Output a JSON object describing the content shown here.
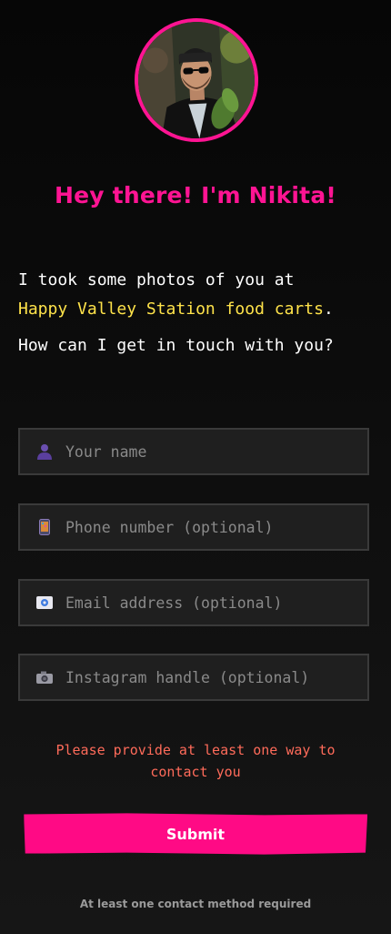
{
  "profile": {
    "avatar_alt": "Nikita profile photo",
    "accent_color": "#ff1493"
  },
  "greeting": "Hey there! I'm Nikita!",
  "intro": {
    "line_before": "I took some photos of you at",
    "location": "Happy Valley Station food carts",
    "line_after": ".",
    "question": "How can I get in touch with you?"
  },
  "form": {
    "name": {
      "placeholder": "Your name",
      "value": "",
      "icon": "person-icon"
    },
    "phone": {
      "placeholder": "Phone number (optional)",
      "value": "",
      "icon": "phone-icon"
    },
    "email": {
      "placeholder": "Email address (optional)",
      "value": "",
      "icon": "email-icon"
    },
    "instagram": {
      "placeholder": "Instagram handle (optional)",
      "value": "",
      "icon": "camera-icon"
    }
  },
  "error_message": "Please provide at least one way to contact you",
  "submit_label": "Submit",
  "footnote": "At least one contact method required",
  "colors": {
    "accent": "#ff1493",
    "highlight": "#ffe34a",
    "error": "#ff6b5a",
    "button": "#ff0a85"
  }
}
